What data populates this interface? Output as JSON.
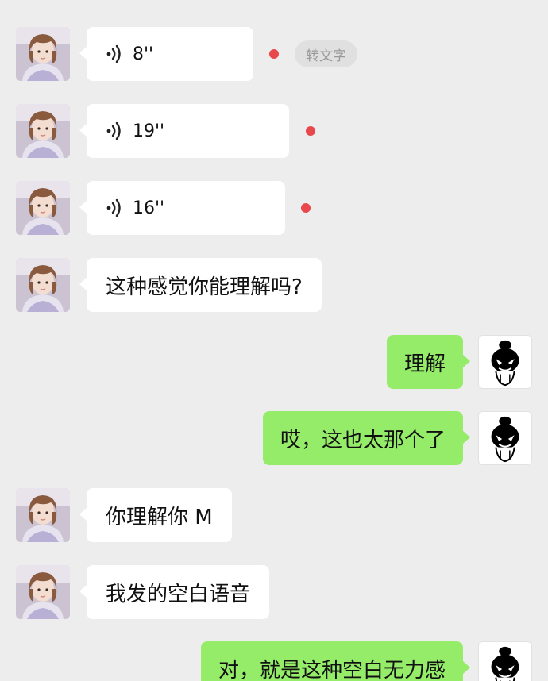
{
  "messages": [
    {
      "side": "left",
      "type": "voice",
      "duration": "8''",
      "unread": true,
      "to_text_label": "转文字"
    },
    {
      "side": "left",
      "type": "voice",
      "duration": "19''",
      "unread": true
    },
    {
      "side": "left",
      "type": "voice",
      "duration": "16''",
      "unread": true
    },
    {
      "side": "left",
      "type": "text",
      "text": "这种感觉你能理解吗?"
    },
    {
      "side": "right",
      "type": "text",
      "text": "理解"
    },
    {
      "side": "right",
      "type": "text",
      "text": "哎，这也太那个了"
    },
    {
      "side": "left",
      "type": "text",
      "text": "你理解你 M"
    },
    {
      "side": "left",
      "type": "text",
      "text": "我发的空白语音"
    },
    {
      "side": "right",
      "type": "text",
      "text": "对，就是这种空白无力感"
    }
  ],
  "colors": {
    "outgoing_bubble": "#95ec69",
    "incoming_bubble": "#ffffff",
    "background": "#ededed",
    "unread_dot": "#e8474b"
  },
  "icons": {
    "voice": "voice-wave-icon",
    "contact_avatar": "girl-photo-avatar",
    "self_avatar": "cartoon-face-avatar"
  }
}
